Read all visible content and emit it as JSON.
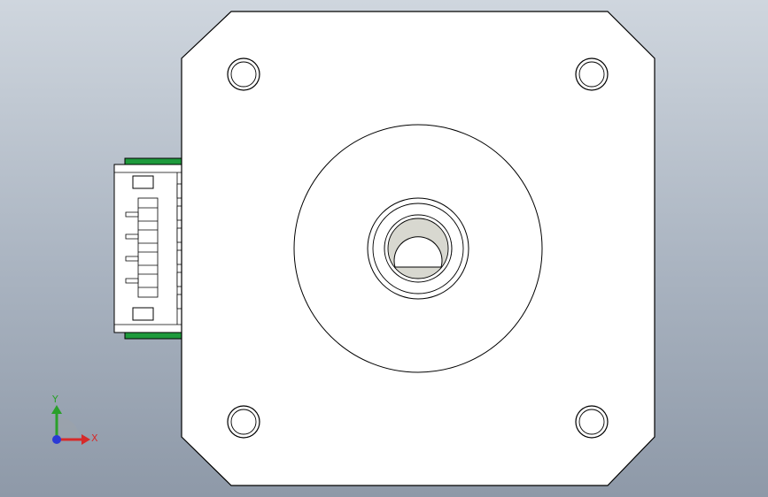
{
  "triad": {
    "x_label": "X",
    "y_label": "Y",
    "x_color": "#d62a2a",
    "y_color": "#2aa02a",
    "z_color": "#2a3ad6"
  },
  "colors": {
    "part_fill": "#ffffff",
    "outline": "#000000",
    "connector_green": "#1e9a3c",
    "shaft_gray": "#d8d8d0"
  },
  "icons": [
    "coordinate-triad-icon"
  ]
}
